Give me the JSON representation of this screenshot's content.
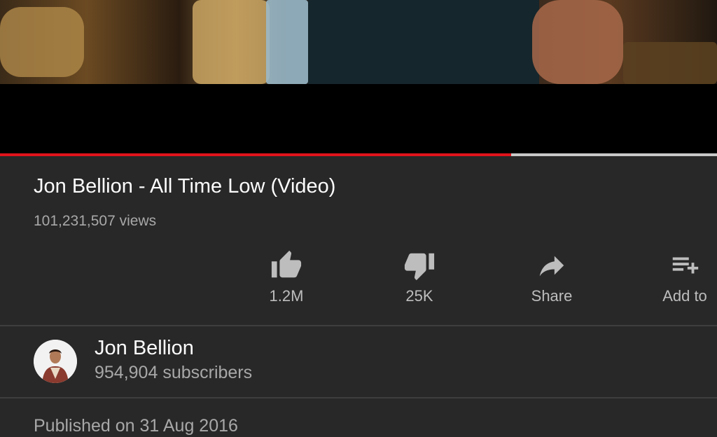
{
  "video": {
    "progress_fraction": 0.713
  },
  "info": {
    "title": "Jon Bellion - All Time Low (Video)",
    "views": "101,231,507 views"
  },
  "actions": [
    {
      "label": "1.2M",
      "icon": "thumbs-up-icon"
    },
    {
      "label": "25K",
      "icon": "thumbs-down-icon"
    },
    {
      "label": "Share",
      "icon": "share-icon"
    },
    {
      "label": "Add to",
      "icon": "add-to-playlist-icon"
    }
  ],
  "channel": {
    "name": "Jon Bellion",
    "subscribers": "954,904 subscribers"
  },
  "description": {
    "published": "Published on 31 Aug 2016"
  },
  "colors": {
    "background": "#282828",
    "progress": "#e0141b",
    "secondary_text": "#a8a8a8"
  }
}
